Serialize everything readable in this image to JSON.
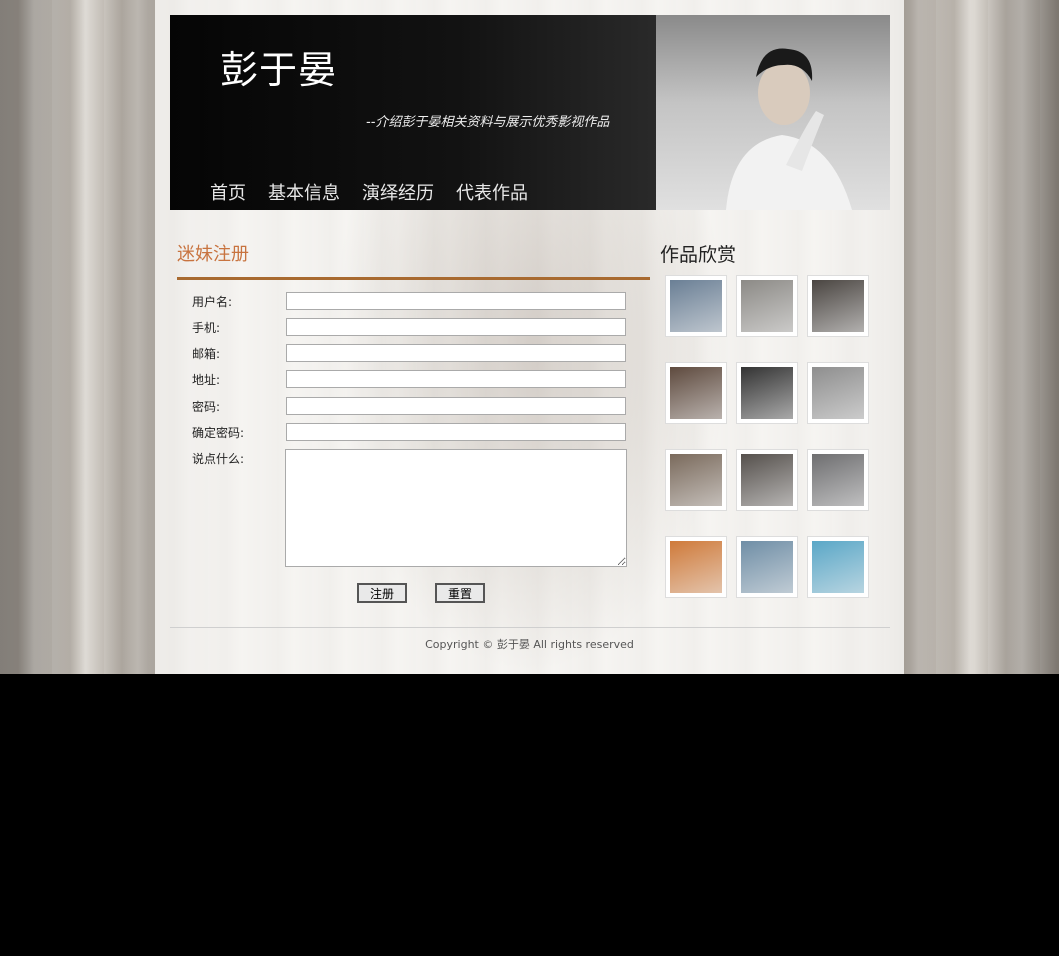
{
  "header": {
    "title": "彭于晏",
    "subtitle": "--介绍彭于晏相关资料与展示优秀影视作品",
    "nav": [
      "首页",
      "基本信息",
      "演绎经历",
      "代表作品"
    ]
  },
  "form": {
    "title": "迷妹注册",
    "fields": [
      {
        "label": "用户名:",
        "value": ""
      },
      {
        "label": "手机:",
        "value": ""
      },
      {
        "label": "邮箱:",
        "value": ""
      },
      {
        "label": "地址:",
        "value": ""
      },
      {
        "label": "密码:",
        "value": ""
      },
      {
        "label": "确定密码:",
        "value": ""
      }
    ],
    "comment_label": "说点什么:",
    "submit_label": "注册",
    "reset_label": "重置"
  },
  "gallery": {
    "title": "作品欣赏",
    "thumbs": [
      {
        "tone": "#6a7f95"
      },
      {
        "tone": "#8c8a86"
      },
      {
        "tone": "#4a4541"
      },
      {
        "tone": "#5e4a3e"
      },
      {
        "tone": "#333333"
      },
      {
        "tone": "#8e8e8e"
      },
      {
        "tone": "#7a6a5c"
      },
      {
        "tone": "#55504c"
      },
      {
        "tone": "#6e6e70"
      },
      {
        "tone": "#cf7a3a"
      },
      {
        "tone": "#6f8ea6"
      },
      {
        "tone": "#5aa7c7"
      }
    ]
  },
  "footer": {
    "copyright": "Copyright © 彭于晏 All rights reserved"
  },
  "colors": {
    "accent": "#c8733f",
    "rule": "#a86a30"
  }
}
